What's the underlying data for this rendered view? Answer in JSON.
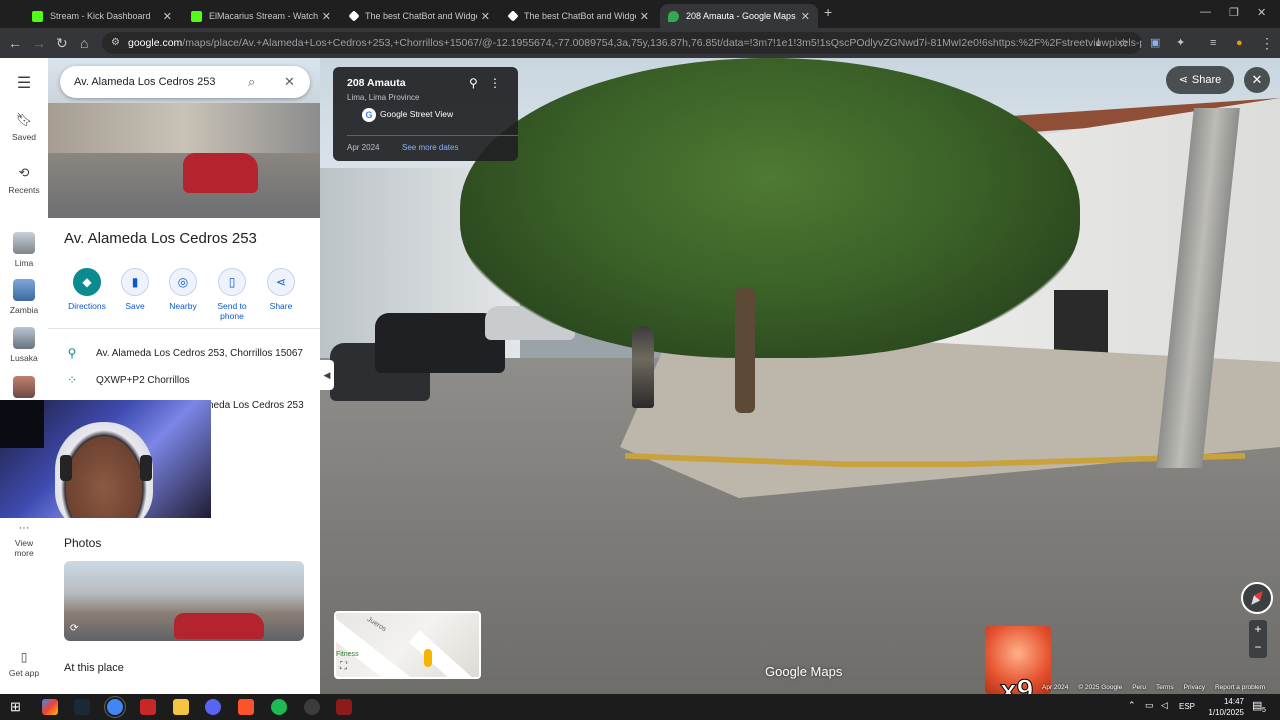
{
  "browser": {
    "tabs": [
      {
        "label": "Stream - Kick Dashboard",
        "fav_color": "#53fc18",
        "active": false
      },
      {
        "label": "ElMacarius Stream - Watch Live",
        "fav_color": "#53fc18",
        "active": false
      },
      {
        "label": "The best ChatBot and Widgets",
        "fav_color": "#ffffff",
        "active": false
      },
      {
        "label": "The best ChatBot and Widgets",
        "fav_color": "#ffffff",
        "active": false
      },
      {
        "label": "208 Amauta - Google Maps",
        "fav_color": "#34a853",
        "active": true
      }
    ],
    "url_host": "google.com",
    "url_rest": "/maps/place/Av.+Alameda+Los+Cedros+253,+Chorrillos+15067/@-12.1955674,-77.0089754,3a,75y,136.87h,76.85t/data=!3m7!1e1!3m5!1sQscPOdlyvZGNwd7i-81MwI2e0!6shttps:%2F%2Fstreetviewpixels-pa.googleapis..."
  },
  "rail": {
    "menu_icon": "hamburger-icon",
    "items": [
      {
        "label": "Saved",
        "icon": "bookmark-icon"
      },
      {
        "label": "Recents",
        "icon": "history-icon"
      },
      {
        "label": "Lima"
      },
      {
        "label": "Zambia"
      },
      {
        "label": "Lusaka"
      }
    ],
    "view_more": "View more",
    "get_app": "Get app"
  },
  "panel": {
    "search_value": "Av. Alameda Los Cedros 253",
    "title": "Av. Alameda Los Cedros 253",
    "actions": [
      {
        "label": "Directions",
        "icon": "directions-icon"
      },
      {
        "label": "Save",
        "icon": "bookmark-icon"
      },
      {
        "label": "Nearby",
        "icon": "nearby-icon"
      },
      {
        "label": "Send to phone",
        "icon": "phone-icon"
      },
      {
        "label": "Share",
        "icon": "share-icon"
      }
    ],
    "address": "Av. Alameda Los Cedros 253, Chorrillos 15067",
    "plus_code": "QXWP+P2 Chorrillos",
    "partial_row": "neda Los Cedros 253",
    "photos_heading": "Photos",
    "at_this_place": "At this place"
  },
  "streetview": {
    "place_name": "208 Amauta",
    "place_region": "Lima, Lima Province",
    "source": "Google Street View",
    "date": "Apr 2024",
    "more_dates": "See more dates",
    "share_label": "Share",
    "minimap_label_1": "Fitness",
    "minimap_label_2": "Jueros",
    "logo": "Google Maps",
    "footer": [
      "Apr 2024",
      "© 2025 Google",
      "Peru",
      "Terms",
      "Privacy",
      "Report a problem"
    ],
    "sticker_text": "x9"
  },
  "taskbar": {
    "language": "ESP",
    "time": "14:47",
    "date": "1/10/2025",
    "notif_count": "5"
  },
  "colors": {
    "accent": "#0b57d0",
    "teal": "#0b8a8f"
  }
}
